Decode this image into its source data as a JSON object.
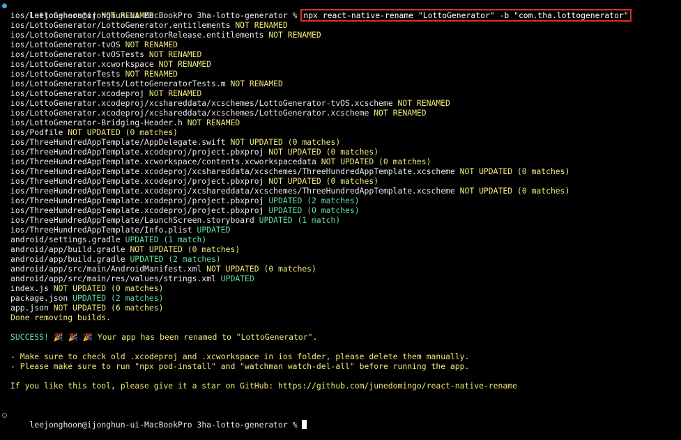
{
  "prompt": "leejonghoon@ijonghun-ui-MacBookPro 3ha-lotto-generator % ",
  "command": "npx react-native-rename \"LottoGenerator\" -b \"com.tha.lottogenerator\"",
  "colors": {
    "background": "#000000",
    "text": "#e8e8e8",
    "warning": "#f0e87a",
    "success": "#64e0a0",
    "highlight_box": "#e0301e",
    "status_dot": "#4aa3df"
  },
  "output": [
    {
      "path": "ios/LottoGenerator",
      "status": "NOT RENAMED",
      "kind": "yellow"
    },
    {
      "path": "ios/LottoGenerator/LottoGenerator.entitlements",
      "status": "NOT RENAMED",
      "kind": "yellow"
    },
    {
      "path": "ios/LottoGenerator/LottoGeneratorRelease.entitlements",
      "status": "NOT RENAMED",
      "kind": "yellow"
    },
    {
      "path": "ios/LottoGenerator-tvOS",
      "status": "NOT RENAMED",
      "kind": "yellow"
    },
    {
      "path": "ios/LottoGenerator-tvOSTests",
      "status": "NOT RENAMED",
      "kind": "yellow"
    },
    {
      "path": "ios/LottoGenerator.xcworkspace",
      "status": "NOT RENAMED",
      "kind": "yellow"
    },
    {
      "path": "ios/LottoGeneratorTests",
      "status": "NOT RENAMED",
      "kind": "yellow"
    },
    {
      "path": "ios/LottoGeneratorTests/LottoGeneratorTests.m",
      "status": "NOT RENAMED",
      "kind": "yellow"
    },
    {
      "path": "ios/LottoGenerator.xcodeproj",
      "status": "NOT RENAMED",
      "kind": "yellow"
    },
    {
      "path": "ios/LottoGenerator.xcodeproj/xcshareddata/xcschemes/LottoGenerator-tvOS.xcscheme",
      "status": "NOT RENAMED",
      "kind": "yellow"
    },
    {
      "path": "ios/LottoGenerator.xcodeproj/xcshareddata/xcschemes/LottoGenerator.xcscheme",
      "status": "NOT RENAMED",
      "kind": "yellow"
    },
    {
      "path": "ios/LottoGenerator-Bridging-Header.h",
      "status": "NOT RENAMED",
      "kind": "yellow"
    },
    {
      "path": "ios/Podfile",
      "status": "NOT UPDATED (0 matches)",
      "kind": "yellow"
    },
    {
      "path": "ios/ThreeHundredAppTemplate/AppDelegate.swift",
      "status": "NOT UPDATED (0 matches)",
      "kind": "yellow"
    },
    {
      "path": "ios/ThreeHundredAppTemplate.xcodeproj/project.pbxproj",
      "status": "NOT UPDATED (0 matches)",
      "kind": "yellow"
    },
    {
      "path": "ios/ThreeHundredAppTemplate.xcworkspace/contents.xcworkspacedata",
      "status": "NOT UPDATED (0 matches)",
      "kind": "yellow"
    },
    {
      "path": "ios/ThreeHundredAppTemplate.xcodeproj/xcshareddata/xcschemes/ThreeHundredAppTemplate.xcscheme",
      "status": "NOT UPDATED (0 matches)",
      "kind": "yellow"
    },
    {
      "path": "ios/ThreeHundredAppTemplate.xcodeproj/project.pbxproj",
      "status": "NOT UPDATED (0 matches)",
      "kind": "yellow"
    },
    {
      "path": "ios/ThreeHundredAppTemplate.xcodeproj/xcshareddata/xcschemes/ThreeHundredAppTemplate.xcscheme",
      "status": "NOT UPDATED (0 matches)",
      "kind": "yellow"
    },
    {
      "path": "ios/ThreeHundredAppTemplate.xcodeproj/project.pbxproj",
      "status": "UPDATED (2 matches)",
      "kind": "green"
    },
    {
      "path": "ios/ThreeHundredAppTemplate.xcodeproj/project.pbxproj",
      "status": "UPDATED (0 matches)",
      "kind": "green"
    },
    {
      "path": "ios/ThreeHundredAppTemplate/LaunchScreen.storyboard",
      "status": "UPDATED (1 match)",
      "kind": "green"
    },
    {
      "path": "ios/ThreeHundredAppTemplate/Info.plist",
      "status": "UPDATED",
      "kind": "green"
    },
    {
      "path": "android/settings.gradle",
      "status": "UPDATED (1 match)",
      "kind": "green"
    },
    {
      "path": "android/app/build.gradle",
      "status": "NOT UPDATED (0 matches)",
      "kind": "yellow"
    },
    {
      "path": "android/app/build.gradle",
      "status": "UPDATED (2 matches)",
      "kind": "green"
    },
    {
      "path": "android/app/src/main/AndroidManifest.xml",
      "status": "NOT UPDATED (0 matches)",
      "kind": "yellow"
    },
    {
      "path": "android/app/src/main/res/values/strings.xml",
      "status": "UPDATED",
      "kind": "green"
    },
    {
      "path": "index.js",
      "status": "NOT UPDATED (0 matches)",
      "kind": "yellow"
    },
    {
      "path": "package.json",
      "status": "UPDATED (2 matches)",
      "kind": "green"
    },
    {
      "path": "app.json",
      "status": "NOT UPDATED (6 matches)",
      "kind": "yellow"
    }
  ],
  "done_text": "Done removing builds.",
  "success": {
    "label": "SUCCESS!",
    "emoji": "🎉 🎉 🎉",
    "message": " Your app has been renamed to \"LottoGenerator\"."
  },
  "notes": [
    "- Make sure to check old .xcodeproj and .xcworkspace in ios folder, please delete them manually.",
    "- Please make sure to run \"npx pod-install\" and \"watchman watch-del-all\" before running the app."
  ],
  "star_text": "If you like this tool, please give it a star on GitHub: https://github.com/junedomingo/react-native-rename",
  "final_prompt": "leejonghoon@ijonghun-ui-MacBookPro 3ha-lotto-generator % "
}
